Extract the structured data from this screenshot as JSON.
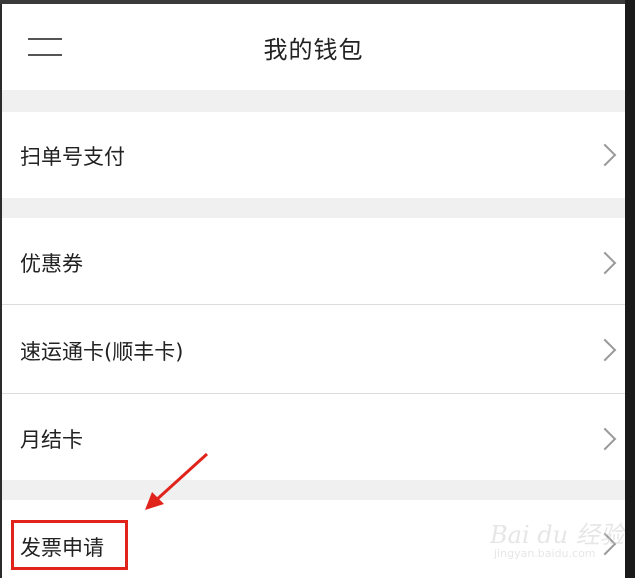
{
  "header": {
    "title": "我的钱包"
  },
  "wallet": {
    "items": [
      {
        "label": "扫单号支付"
      },
      {
        "label": "优惠券"
      },
      {
        "label": "速运通卡(顺丰卡)"
      },
      {
        "label": "月结卡"
      },
      {
        "label": "发票申请"
      }
    ]
  },
  "annotation": {
    "highlight_color": "#e0241c"
  },
  "watermark": {
    "logo_text": "Bai du 经验",
    "url_text": "jingyan.baidu.com"
  }
}
